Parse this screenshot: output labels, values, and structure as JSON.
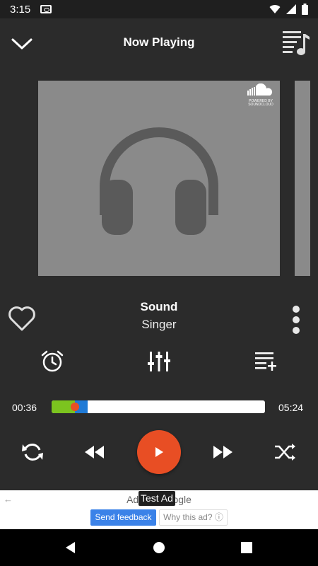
{
  "status_bar": {
    "time": "3:15"
  },
  "header": {
    "title": "Now Playing"
  },
  "artwork": {
    "badge_line1": "POWERED BY",
    "badge_line2": "SOUNDCLOUD"
  },
  "track": {
    "title": "Sound",
    "artist": "Singer"
  },
  "progress": {
    "elapsed": "00:36",
    "total": "05:24",
    "played_fraction": 0.11,
    "buffered_fraction": 0.17
  },
  "ad": {
    "label": "Ads by Google",
    "tooltip": "Test Ad",
    "feedback_label": "Send feedback",
    "why_label": "Why this ad? ⓘ"
  },
  "colors": {
    "accent": "#e84e24",
    "progress_played": "#7cc41f",
    "progress_buffered": "#1f7ad6",
    "background": "#2b2b2b",
    "ad_button": "#3b82e8"
  },
  "icons": [
    "cast-icon",
    "wifi-icon",
    "signal-icon",
    "battery-icon",
    "chevron-down-icon",
    "playlist-icon",
    "soundcloud-icon",
    "headphones-icon",
    "heart-icon",
    "more-vert-icon",
    "alarm-icon",
    "equalizer-icon",
    "add-to-queue-icon",
    "repeat-icon",
    "rewind-icon",
    "play-icon",
    "fast-forward-icon",
    "shuffle-icon",
    "back-arrow-icon",
    "nav-back-icon",
    "nav-home-icon",
    "nav-recents-icon"
  ]
}
